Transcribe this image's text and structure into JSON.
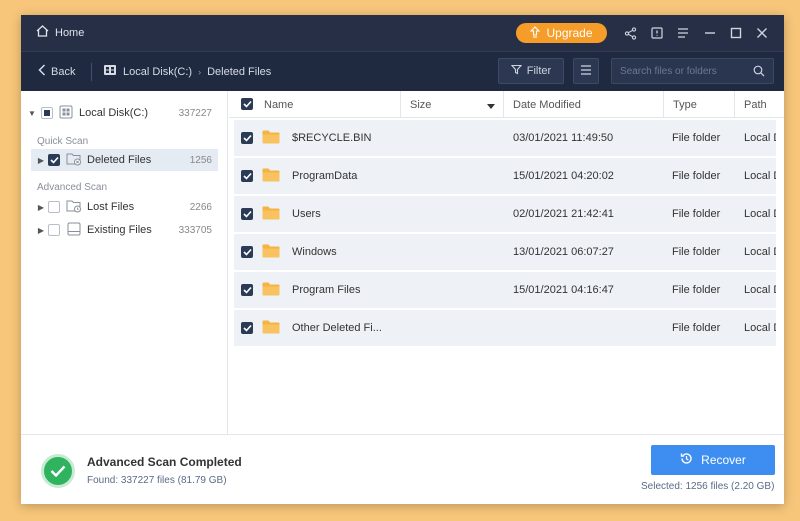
{
  "titlebar": {
    "home_label": "Home",
    "upgrade_label": "Upgrade",
    "icons": [
      "share-icon",
      "feedback-icon",
      "menu-icon",
      "minimize-icon",
      "maximize-icon",
      "close-icon"
    ]
  },
  "toolbar": {
    "back_label": "Back",
    "breadcrumb": [
      "Local Disk(C:)",
      "Deleted Files"
    ],
    "filter_label": "Filter",
    "search_placeholder": "Search files or folders"
  },
  "sidebar": {
    "root": {
      "label": "Local Disk(C:)",
      "count": "337227"
    },
    "quick_scan_label": "Quick Scan",
    "quick_items": [
      {
        "label": "Deleted Files",
        "count": "1256",
        "checked": true
      }
    ],
    "advanced_scan_label": "Advanced Scan",
    "advanced_items": [
      {
        "label": "Lost Files",
        "count": "2266",
        "checked": false
      },
      {
        "label": "Existing Files",
        "count": "333705",
        "checked": false
      }
    ]
  },
  "table": {
    "columns": [
      "Name",
      "Size",
      "Date Modified",
      "Type",
      "Path"
    ],
    "rows": [
      {
        "name": "$RECYCLE.BIN",
        "size": "",
        "date": "03/01/2021 11:49:50",
        "type": "File folder",
        "path": "Local Dis..."
      },
      {
        "name": "ProgramData",
        "size": "",
        "date": "15/01/2021 04:20:02",
        "type": "File folder",
        "path": "Local Dis..."
      },
      {
        "name": "Users",
        "size": "",
        "date": "02/01/2021 21:42:41",
        "type": "File folder",
        "path": "Local Dis..."
      },
      {
        "name": "Windows",
        "size": "",
        "date": "13/01/2021 06:07:27",
        "type": "File folder",
        "path": "Local Dis..."
      },
      {
        "name": "Program Files",
        "size": "",
        "date": "15/01/2021 04:16:47",
        "type": "File folder",
        "path": "Local Dis..."
      },
      {
        "name": "Other Deleted Fi...",
        "size": "",
        "date": "",
        "type": "File folder",
        "path": "Local Dis..."
      }
    ]
  },
  "footer": {
    "status_title": "Advanced Scan Completed",
    "status_found": "Found: 337227 files (81.79 GB)",
    "recover_label": "Recover",
    "selected_text": "Selected: 1256 files (2.20 GB)"
  },
  "colors": {
    "background": "#f7c67a",
    "titlebar": "#262f45",
    "accent": "#3d8ef0",
    "upgrade": "#f59d28",
    "success": "#2fb35f"
  }
}
